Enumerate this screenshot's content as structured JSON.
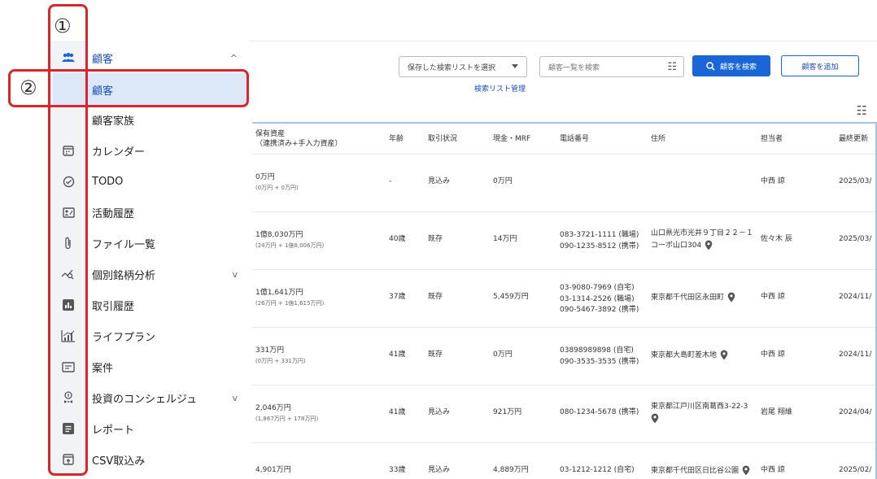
{
  "annotations": {
    "marker1": "①",
    "marker2": "②"
  },
  "sidebar": {
    "items": [
      {
        "label": "顧客",
        "icon": "people-icon",
        "expand": "^",
        "style": "blue"
      },
      {
        "label": "顧客",
        "icon": "",
        "style": "blue-selected"
      },
      {
        "label": "顧客家族",
        "icon": ""
      },
      {
        "label": "カレンダー",
        "icon": "calendar-icon"
      },
      {
        "label": "TODO",
        "icon": "check-circle-icon"
      },
      {
        "label": "活動履歴",
        "icon": "contact-card-icon"
      },
      {
        "label": "ファイル一覧",
        "icon": "paperclip-icon"
      },
      {
        "label": "個別銘柄分析",
        "icon": "chart-search-icon",
        "expand": "v"
      },
      {
        "label": "取引履歴",
        "icon": "bar-chart-icon"
      },
      {
        "label": "ライフプラン",
        "icon": "growth-chart-icon"
      },
      {
        "label": "案件",
        "icon": "document-list-icon"
      },
      {
        "label": "投資のコンシェルジュ",
        "icon": "concierge-icon",
        "expand": "v"
      },
      {
        "label": "レポート",
        "icon": "report-icon"
      },
      {
        "label": "CSV取込み",
        "icon": "upload-tray-icon"
      }
    ]
  },
  "toolbar": {
    "saved_search_select": "保存した検索リストを選択",
    "search_placeholder": "顧客一覧を検索",
    "search_button": "顧客を検索",
    "add_button": "顧客を追加",
    "manage_link": "検索リスト管理",
    "tune_icon": "☷"
  },
  "table": {
    "headers": {
      "assets": "保有資産",
      "assets_sub": "（連携済み+手入力資産）",
      "age": "年齢",
      "status": "取引状況",
      "cash": "現金・MRF",
      "phone": "電話番号",
      "address": "住所",
      "owner": "担当者",
      "updated": "最終更新"
    },
    "rows": [
      {
        "assets": "0万円",
        "assets_detail": "(0万円 + 0万円)",
        "age": "-",
        "status": "見込み",
        "cash": "0万円",
        "phones": [],
        "address": "",
        "pin": false,
        "owner": "中西 諒",
        "updated": "2025/03/"
      },
      {
        "assets": "1億8,030万円",
        "assets_detail": "(24万円 + 1億8,006万円)",
        "age": "40歳",
        "status": "既存",
        "cash": "14万円",
        "phones": [
          "083-3721-1111 (職場)",
          "090-1235-8512 (携帯)"
        ],
        "address": "山口県光市光井９丁目２２－１",
        "address2": "コーポ山口304",
        "pin": true,
        "owner": "佐々木 辰",
        "updated": "2025/03/"
      },
      {
        "assets": "1億1,641万円",
        "assets_detail": "(26万円 + 1億1,615万円)",
        "age": "37歳",
        "status": "既存",
        "cash": "5,459万円",
        "phones": [
          "03-9080-7969 (自宅)",
          "03-1314-2526 (職場)",
          "090-5467-3892 (携帯)"
        ],
        "address": "東京都千代田区永田町",
        "pin": true,
        "owner": "中西 諒",
        "updated": "2024/11/"
      },
      {
        "assets": "331万円",
        "assets_detail": "(0万円 + 331万円)",
        "age": "41歳",
        "status": "既存",
        "cash": "0万円",
        "phones": [
          "03898989898 (自宅)",
          "090-3535-3535 (携帯)"
        ],
        "address": "東京都大島町差木地",
        "pin": true,
        "owner": "中西 諒",
        "updated": "2024/11/"
      },
      {
        "assets": "2,046万円",
        "assets_detail": "(1,867万円 + 178万円)",
        "age": "41歳",
        "status": "見込み",
        "cash": "921万円",
        "phones": [
          "080-1234-5678 (携帯)"
        ],
        "address": "東京都江戸川区南葛西3-22-3",
        "pin": true,
        "pin_below": true,
        "owner": "岩尾 翔維",
        "updated": "2024/04/"
      },
      {
        "assets": "4,901万円",
        "assets_detail": "",
        "age": "33歳",
        "status": "見込み",
        "cash": "4,889万円",
        "phones": [
          "03-1212-1212 (自宅)"
        ],
        "address": "東京都千代田区日比谷公園",
        "pin": true,
        "owner": "中西 諒",
        "updated": "2025/02/"
      }
    ]
  },
  "colors": {
    "accent": "#1a66d6",
    "annotation_red": "#d9262c",
    "selected_bg": "#dce7f7",
    "rail_bg": "#f1f3f6"
  }
}
